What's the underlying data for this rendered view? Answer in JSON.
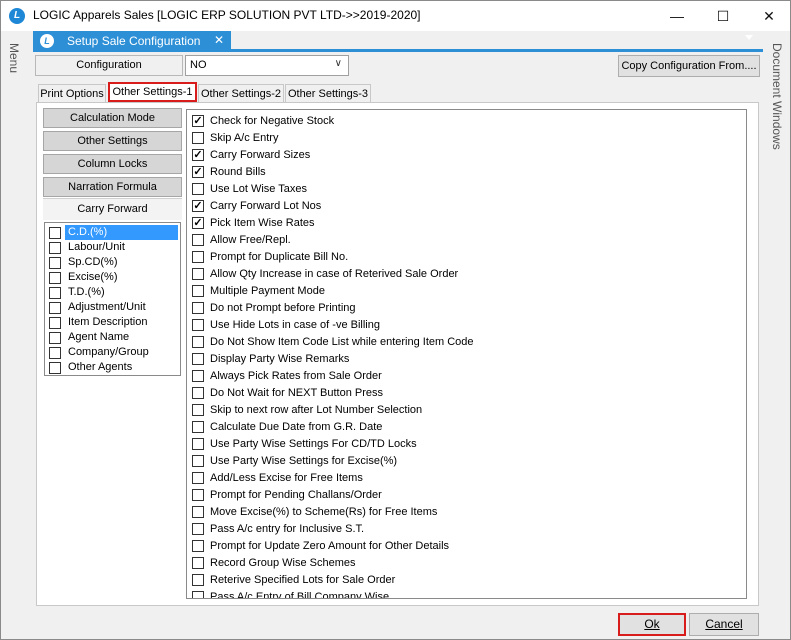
{
  "window": {
    "title": "LOGIC Apparels Sales  [LOGIC ERP SOLUTION PVT LTD->>2019-2020]",
    "minimize": "—",
    "maximize": "☐",
    "close": "✕"
  },
  "side_strips": {
    "menu_label": "Menu",
    "document_windows_label": "Document Windows"
  },
  "mdi_tab": {
    "title": "Setup Sale Configuration",
    "close": "✕"
  },
  "configuration": {
    "label": "Configuration",
    "value": "NO",
    "copy_button": "Copy Configuration From...."
  },
  "tabs": [
    {
      "label": "Print Options"
    },
    {
      "label": "Other Settings-1",
      "active": true
    },
    {
      "label": "Other Settings-2"
    },
    {
      "label": "Other Settings-3"
    }
  ],
  "side_buttons": [
    "Calculation Mode",
    "Other Settings",
    "Column Locks",
    "Narration Formula"
  ],
  "carry_forward": {
    "header": "Carry Forward",
    "items": [
      {
        "label": "C.D.(%)",
        "checked": false,
        "selected": true
      },
      {
        "label": "Labour/Unit",
        "checked": false
      },
      {
        "label": "Sp.CD(%)",
        "checked": false
      },
      {
        "label": "Excise(%)",
        "checked": false
      },
      {
        "label": "T.D.(%)",
        "checked": false
      },
      {
        "label": "Adjustment/Unit",
        "checked": false
      },
      {
        "label": "Item Description",
        "checked": false
      },
      {
        "label": "Agent Name",
        "checked": false
      },
      {
        "label": "Company/Group",
        "checked": false
      },
      {
        "label": "Other Agents",
        "checked": false
      }
    ]
  },
  "settings": [
    {
      "label": "Check for Negative Stock",
      "checked": true
    },
    {
      "label": "Skip A/c Entry",
      "checked": false
    },
    {
      "label": "Carry Forward Sizes",
      "checked": true
    },
    {
      "label": "Round Bills",
      "checked": true
    },
    {
      "label": "Use Lot Wise Taxes",
      "checked": false
    },
    {
      "label": "Carry Forward Lot Nos",
      "checked": true
    },
    {
      "label": "Pick Item Wise Rates",
      "checked": true
    },
    {
      "label": "Allow Free/Repl.",
      "checked": false
    },
    {
      "label": "Prompt for Duplicate Bill No.",
      "checked": false
    },
    {
      "label": "Allow Qty Increase in case of Reterived Sale Order",
      "checked": false
    },
    {
      "label": "Multiple Payment Mode",
      "checked": false
    },
    {
      "label": "Do not Prompt before Printing",
      "checked": false
    },
    {
      "label": "Use Hide Lots in case of -ve Billing",
      "checked": false
    },
    {
      "label": "Do Not Show Item Code List while entering Item Code",
      "checked": false
    },
    {
      "label": "Display Party Wise Remarks",
      "checked": false
    },
    {
      "label": "Always Pick Rates from Sale Order",
      "checked": false
    },
    {
      "label": "Do Not Wait for NEXT Button Press",
      "checked": false
    },
    {
      "label": "Skip to next row after Lot Number Selection",
      "checked": false
    },
    {
      "label": "Calculate Due Date from G.R. Date",
      "checked": false
    },
    {
      "label": "Use Party Wise Settings For CD/TD Locks",
      "checked": false
    },
    {
      "label": "Use Party Wise Settings for Excise(%)",
      "checked": false
    },
    {
      "label": "Add/Less Excise for Free Items",
      "checked": false
    },
    {
      "label": "Prompt for Pending Challans/Order",
      "checked": false
    },
    {
      "label": "Move Excise(%) to Scheme(Rs) for Free Items",
      "checked": false
    },
    {
      "label": "Pass A/c entry for Inclusive S.T.",
      "checked": false
    },
    {
      "label": "Prompt for Update Zero Amount for Other Details",
      "checked": false
    },
    {
      "label": "Record Group Wise Schemes",
      "checked": false
    },
    {
      "label": "Reterive Specified Lots for Sale Order",
      "checked": false
    },
    {
      "label": "Pass A/c Entry of Bill Company Wise",
      "checked": false
    }
  ],
  "footer": {
    "ok": "Ok",
    "cancel": "Cancel"
  }
}
